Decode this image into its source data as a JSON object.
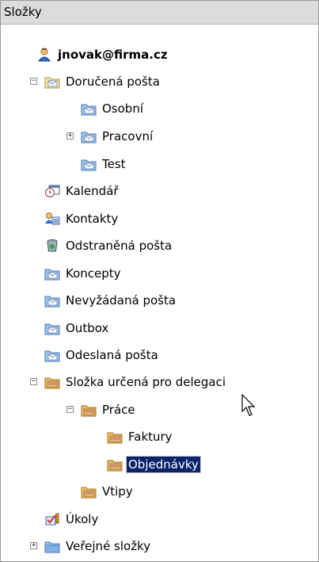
{
  "panel": {
    "title": "Složky"
  },
  "tree": {
    "account": "jnovak@firma.cz",
    "inbox": "Doručená pošta",
    "inbox_children": [
      "Osobní",
      "Pracovní",
      "Test"
    ],
    "calendar": "Kalendář",
    "contacts": "Kontakty",
    "deleted": "Odstraněná pošta",
    "drafts": "Koncepty",
    "junk": "Nevyžádaná pošta",
    "outbox": "Outbox",
    "sent": "Odeslaná pošta",
    "delegation": "Složka určená pro delegaci",
    "work": "Práce",
    "invoices": "Faktury",
    "orders": "Objednávky",
    "jokes": "Vtipy",
    "tasks": "Úkoly",
    "public": "Veřejné složky"
  },
  "icons": {
    "user": "user-icon",
    "mail_folder": "mail-folder-icon",
    "calendar": "calendar-icon",
    "contacts": "contacts-icon",
    "trash": "trash-icon",
    "shared_folder": "shared-folder-icon",
    "tasks": "tasks-icon",
    "public_folder": "public-folder-icon"
  },
  "colors": {
    "selection": "#0a246a",
    "folder": "#6f9fd8"
  }
}
